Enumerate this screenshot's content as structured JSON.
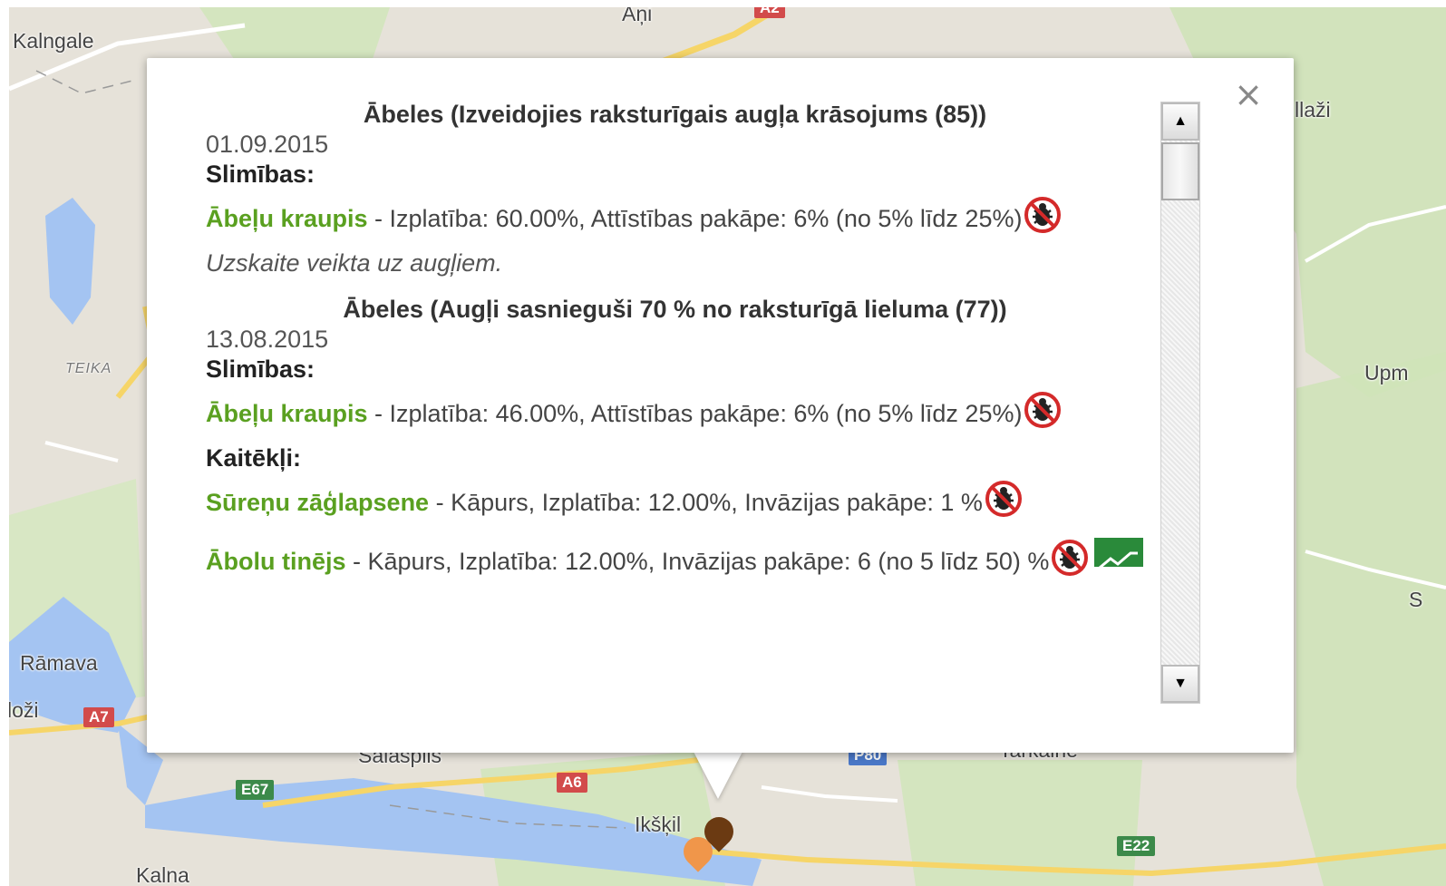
{
  "map": {
    "labels": {
      "kalngale": "Kalngale",
      "ani": "Aņi",
      "allazi": "llaži",
      "teika": "TEIKA",
      "upm": "Upm",
      "s": "S",
      "ramava": "Rāmava",
      "lozi": "loži",
      "salaspils": "Salaspils",
      "tarkaine": "Tarkaine",
      "ikskile": "Ikšķil",
      "kalna": "Kalna"
    },
    "shields": {
      "a2": "A2",
      "a7": "A7",
      "e67": "E67",
      "a6": "A6",
      "p80": "P80",
      "e22": "E22"
    },
    "colors": {
      "land": "#e6e2d9",
      "water": "#a4c4f2",
      "park": "#cfe3b8",
      "road_major": "#f6d568",
      "road_minor": "#ffffff"
    }
  },
  "popup": {
    "close_label": "×",
    "entries": [
      {
        "title": "Ābeles (Izveidojies raksturīgais augļa krāsojums (85))",
        "date": "01.09.2015",
        "sections": [
          {
            "label": "Slimības:",
            "items": [
              {
                "name": "Ābeļu kraupis",
                "desc": " - Izplatība: 60.00%, Attīstības pakāpe: 6% (no 5% līdz 25%)",
                "icons": [
                  "pest-warning-icon"
                ]
              }
            ]
          }
        ],
        "note": "Uzskaite veikta uz augļiem."
      },
      {
        "title": "Ābeles (Augļi sasnieguši 70 % no raksturīgā lieluma (77))",
        "date": "13.08.2015",
        "sections": [
          {
            "label": "Slimības:",
            "items": [
              {
                "name": "Ābeļu kraupis",
                "desc": " - Izplatība: 46.00%, Attīstības pakāpe: 6% (no 5% līdz 25%)",
                "icons": [
                  "pest-warning-icon"
                ]
              }
            ]
          },
          {
            "label": "Kaitēkļi:",
            "items": [
              {
                "name": "Sūreņu zāģlapsene",
                "desc": " - Kāpurs, Izplatība: 12.00%, Invāzijas pakāpe: 1 %",
                "icons": [
                  "pest-warning-icon"
                ]
              },
              {
                "name": "Ābolu tinējs",
                "desc": " - Kāpurs, Izplatība: 12.00%, Invāzijas pakāpe: 6 (no 5 līdz 50) %",
                "icons": [
                  "pest-warning-icon",
                  "trend-chart-icon"
                ]
              }
            ]
          }
        ],
        "note": ""
      }
    ]
  },
  "scrollbar": {
    "up_glyph": "▲",
    "down_glyph": "▼"
  },
  "markers": [
    {
      "name": "marker-dark-brown",
      "color": "#6b3a12"
    },
    {
      "name": "marker-orange",
      "color": "#f0964a"
    }
  ]
}
